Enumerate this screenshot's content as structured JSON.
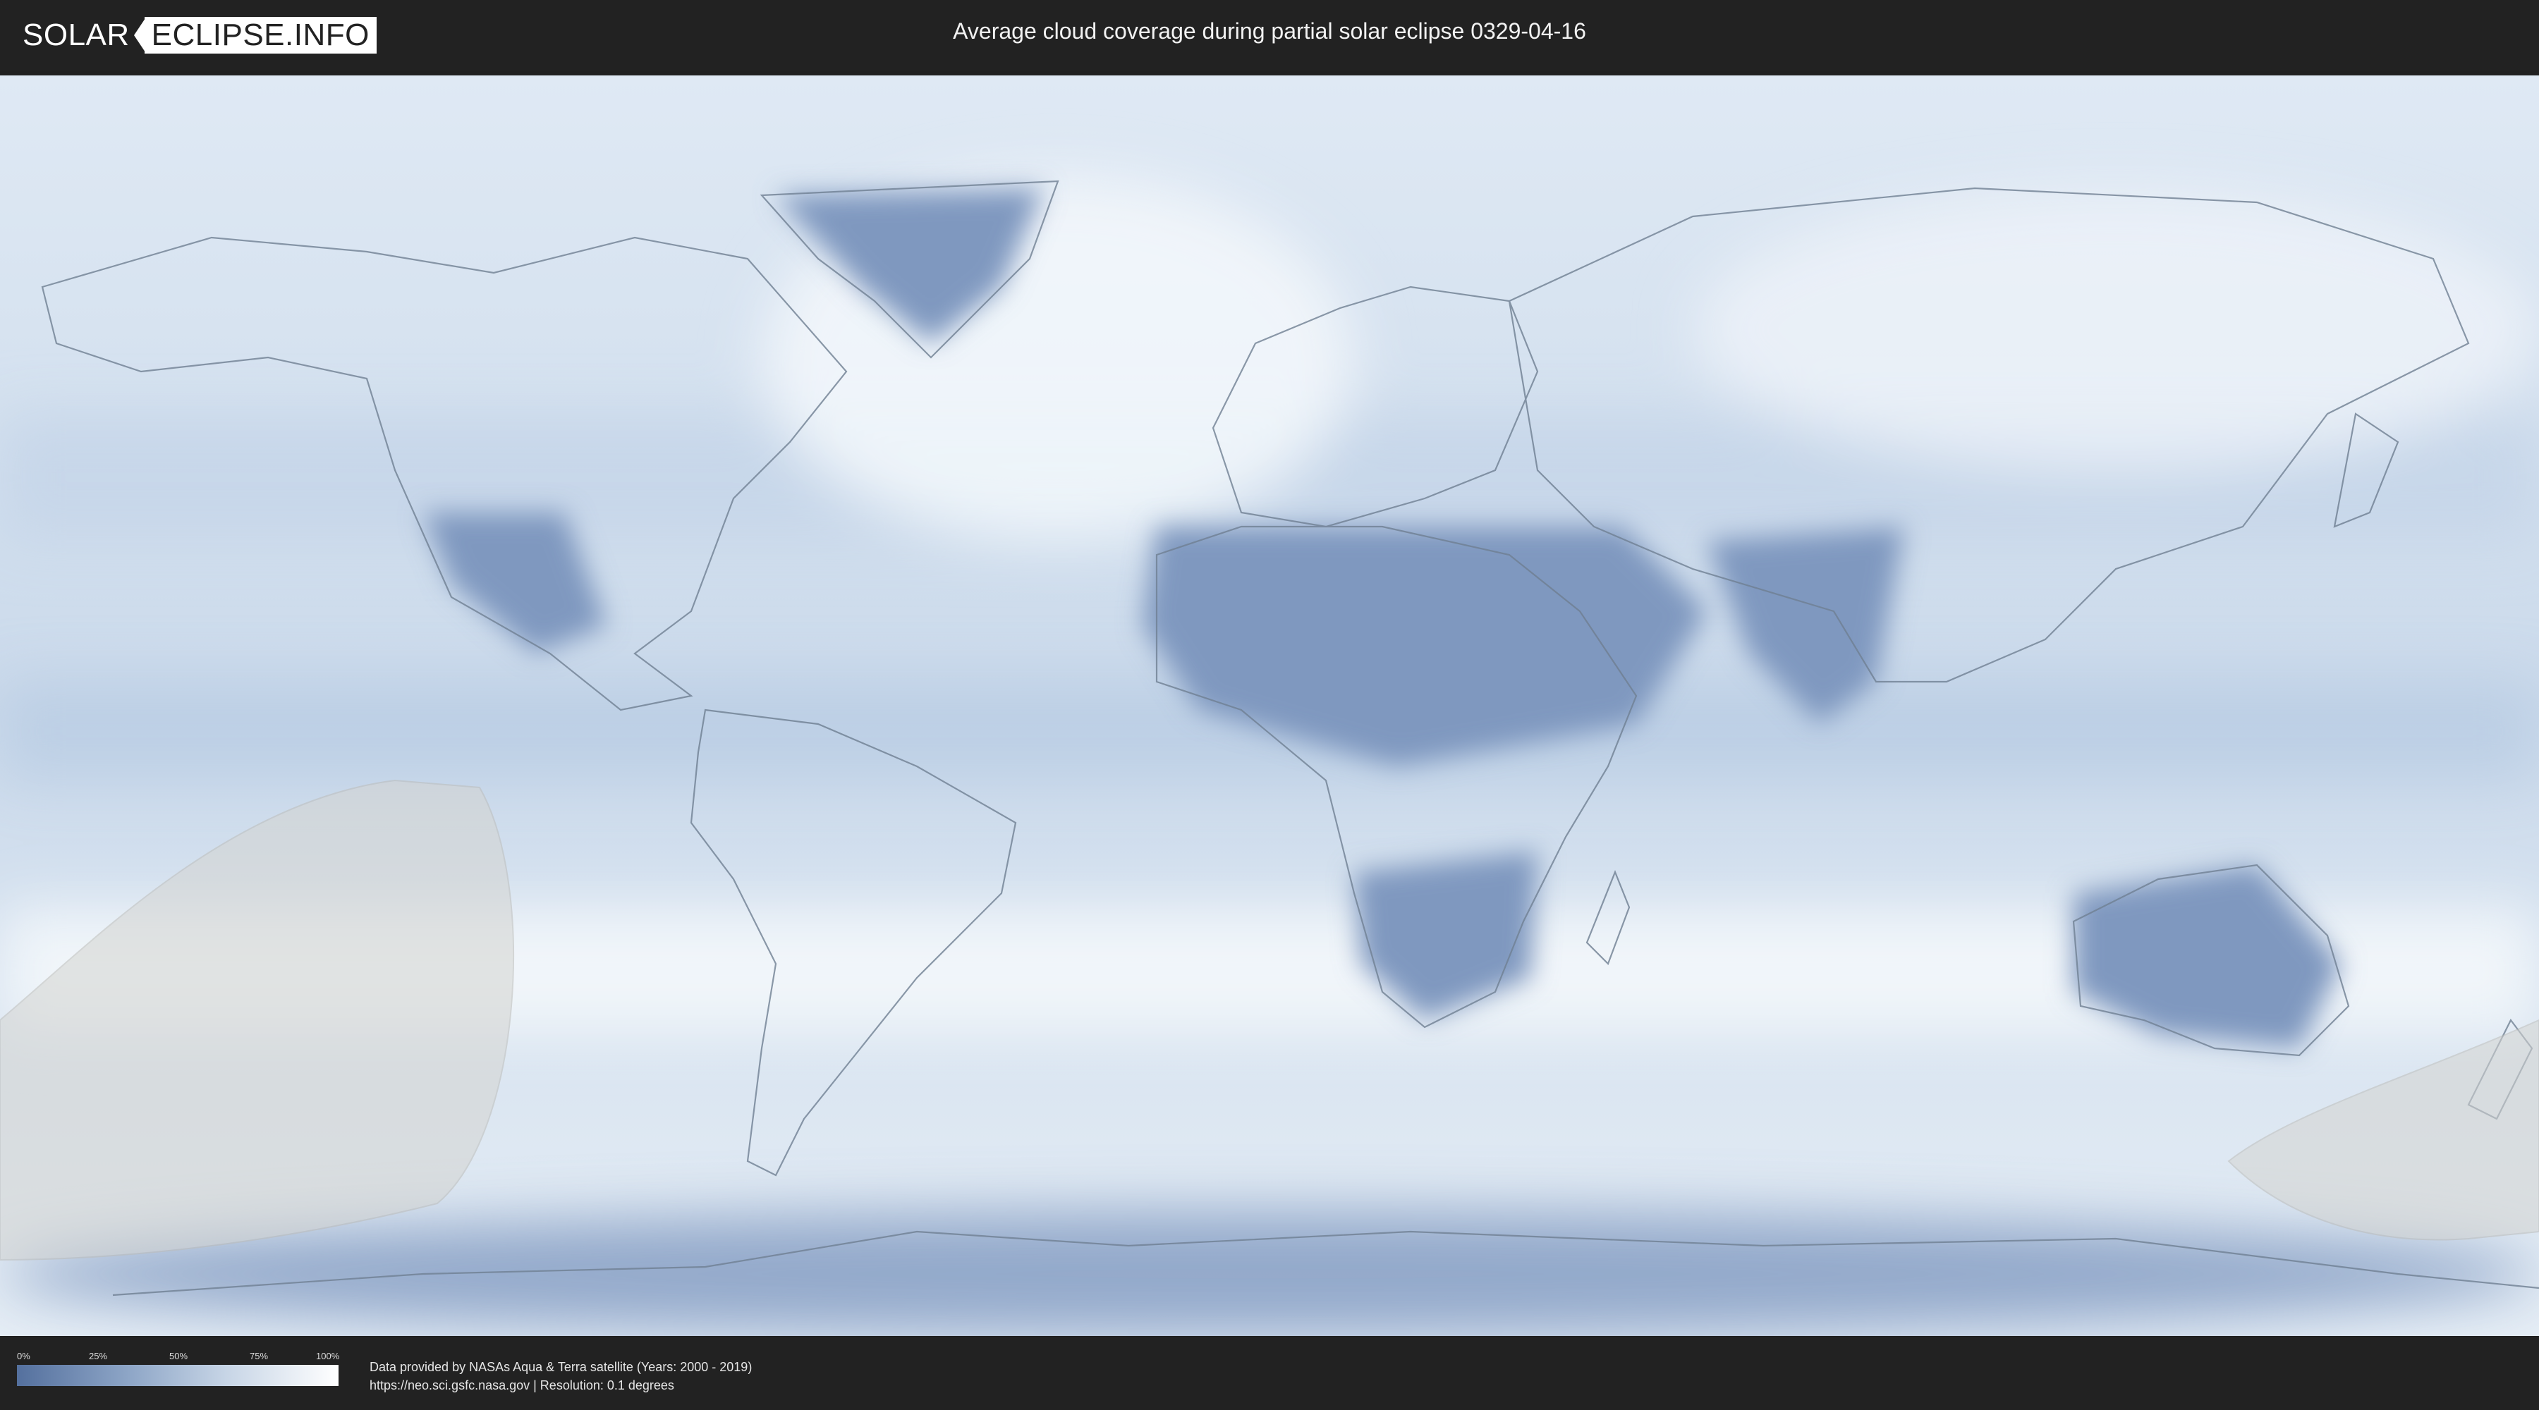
{
  "header": {
    "logo_left": "SOLAR",
    "logo_right": "ECLIPSE.INFO",
    "title": "Average cloud coverage during partial solar eclipse 0329-04-16"
  },
  "map": {
    "description_layer": "cloud-coverage",
    "colors": {
      "clear": "#54709e",
      "cloudy": "#ffffff",
      "land_border": "#6f7f92",
      "eclipse_shade": "#d3d3d0"
    }
  },
  "footer": {
    "legend": {
      "labels": [
        "0%",
        "25%",
        "50%",
        "75%",
        "100%"
      ]
    },
    "credits_line1": "Data provided by NASAs Aqua & Terra satellite (Years: 2000 - 2019)",
    "credits_line2": "https://neo.sci.gsfc.nasa.gov | Resolution: 0.1 degrees"
  }
}
